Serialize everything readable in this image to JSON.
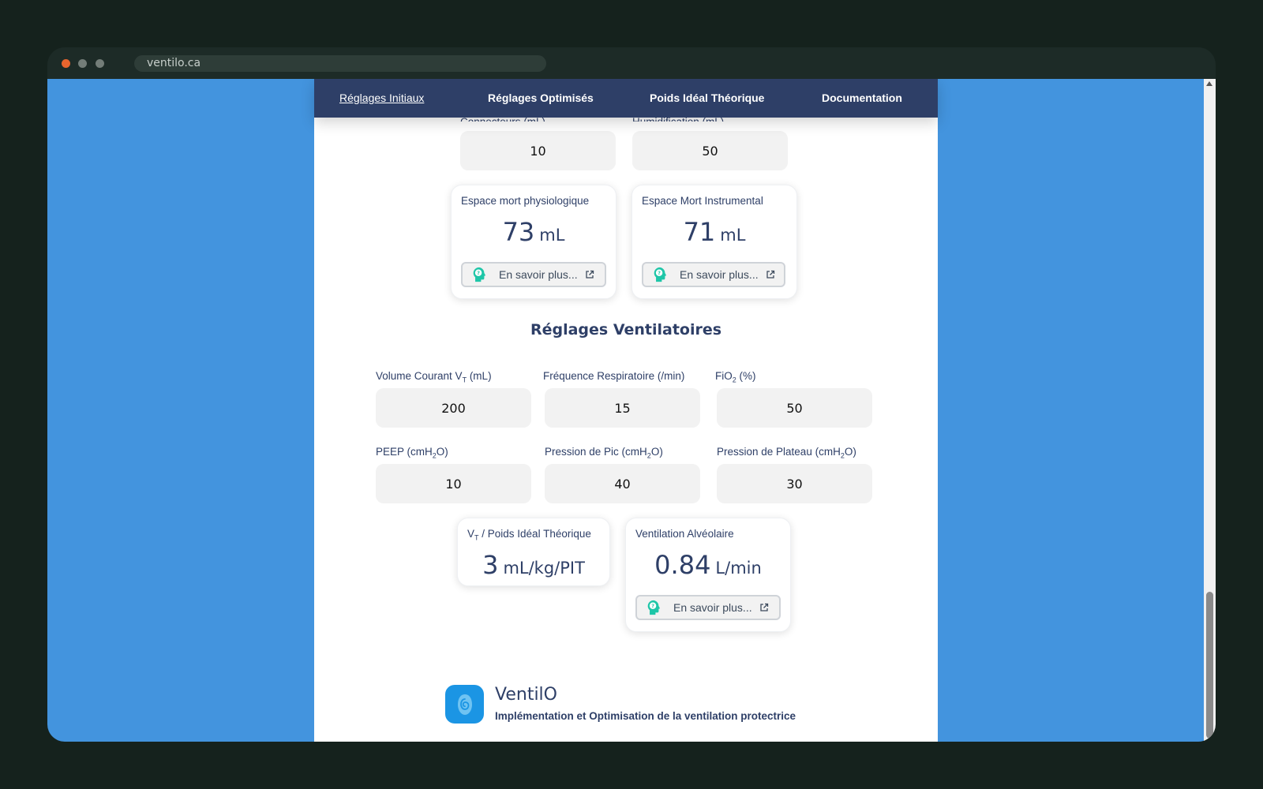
{
  "browser": {
    "url": "ventilo.ca"
  },
  "nav": {
    "items": [
      "Réglages Initiaux",
      "Réglages Optimisés",
      "Poids Idéal Théorique",
      "Documentation"
    ],
    "active_index": 0
  },
  "top": {
    "connectors_label": "Connecteurs (mL)",
    "connectors_value": "10",
    "humidification_label": "Humidification (mL)",
    "humidification_value": "50"
  },
  "cards_top": [
    {
      "title": "Espace mort physiologique",
      "value": "73",
      "unit": "mL",
      "more": "En savoir plus..."
    },
    {
      "title": "Espace Mort Instrumental",
      "value": "71",
      "unit": "mL",
      "more": "En savoir plus..."
    }
  ],
  "section": {
    "title": "Réglages Ventilatoires"
  },
  "fields": {
    "vt": {
      "label_pre": "Volume Courant V",
      "label_sub": "T",
      "label_post": " (mL)",
      "value": "200"
    },
    "fr": {
      "label": "Fréquence Respiratoire (/min)",
      "value": "15"
    },
    "fio2": {
      "label_pre": "FiO",
      "label_sub": "2",
      "label_post": " (%)",
      "value": "50"
    },
    "peep": {
      "label_pre": "PEEP (cmH",
      "label_sub": "2",
      "label_post": "O)",
      "value": "10"
    },
    "pic": {
      "label_pre": "Pression de Pic (cmH",
      "label_sub": "2",
      "label_post": "O)",
      "value": "40"
    },
    "plateau": {
      "label_pre": "Pression de Plateau (cmH",
      "label_sub": "2",
      "label_post": "O)",
      "value": "30"
    }
  },
  "cards_bottom": {
    "vt_pit": {
      "title_pre": "V",
      "title_sub": "T",
      "title_post": " / Poids Idéal Théorique",
      "value": "3",
      "unit": "mL/kg/PIT"
    },
    "va": {
      "title": "Ventilation Alvéolaire",
      "value": "0.84",
      "unit": "L/min",
      "more": "En savoir plus..."
    }
  },
  "footer": {
    "brand": "VentilO",
    "tagline": "Implémentation et Optimisation de la ventilation protectrice"
  },
  "colors": {
    "navy": "#2e3f67",
    "accent_teal": "#1ec6a8",
    "page_bg": "#4394de",
    "logo_blue": "#1b95e4"
  },
  "icons": {
    "help": "help-head-icon",
    "external": "external-link-icon",
    "logo": "ventilo-logo-icon"
  }
}
